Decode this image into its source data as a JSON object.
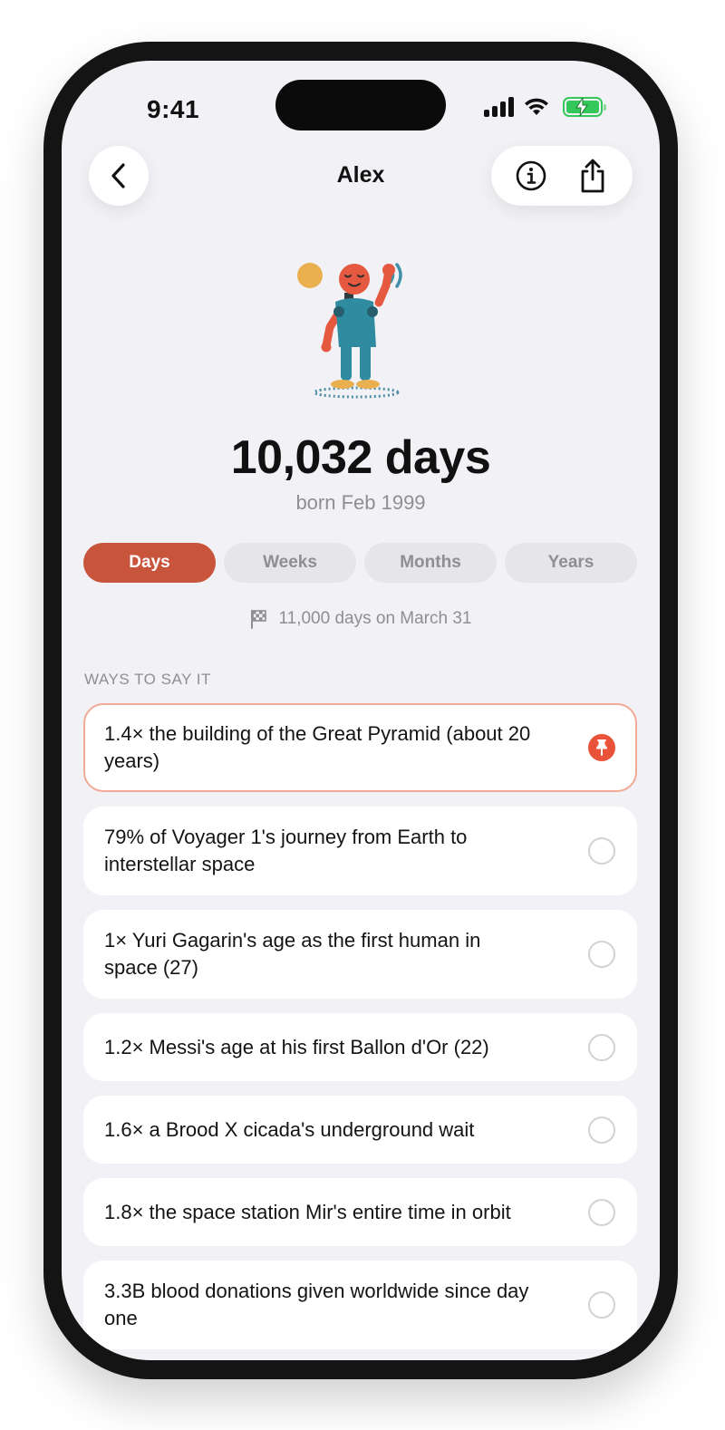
{
  "status": {
    "time": "9:41"
  },
  "nav": {
    "title": "Alex"
  },
  "hero": {
    "count": "10,032 days",
    "born": "born Feb 1999"
  },
  "segments": [
    {
      "label": "Days",
      "active": true
    },
    {
      "label": "Weeks",
      "active": false
    },
    {
      "label": "Months",
      "active": false
    },
    {
      "label": "Years",
      "active": false
    }
  ],
  "milestone": {
    "text": "11,000 days on March 31",
    "icon": "checkered-flag-icon"
  },
  "section": {
    "title": "WAYS TO SAY IT"
  },
  "comparisons": [
    {
      "text": "1.4× the building of the Great Pyramid (about 20 years)",
      "pinned": true
    },
    {
      "text": "79% of Voyager 1's journey from Earth to interstellar space",
      "pinned": false
    },
    {
      "text": "1× Yuri Gagarin's age as the first human in space (27)",
      "pinned": false
    },
    {
      "text": "1.2× Messi's age at his first Ballon d'Or (22)",
      "pinned": false
    },
    {
      "text": "1.6× a Brood X cicada's underground wait",
      "pinned": false
    },
    {
      "text": "1.8× the space station Mir's entire time in orbit",
      "pinned": false
    },
    {
      "text": "3.3B blood donations given worldwide since day one",
      "pinned": false
    }
  ],
  "colors": {
    "accent": "#c9543c",
    "pin": "#e8533a",
    "pinned_border": "#f2a996",
    "background": "#f2f2f6"
  }
}
